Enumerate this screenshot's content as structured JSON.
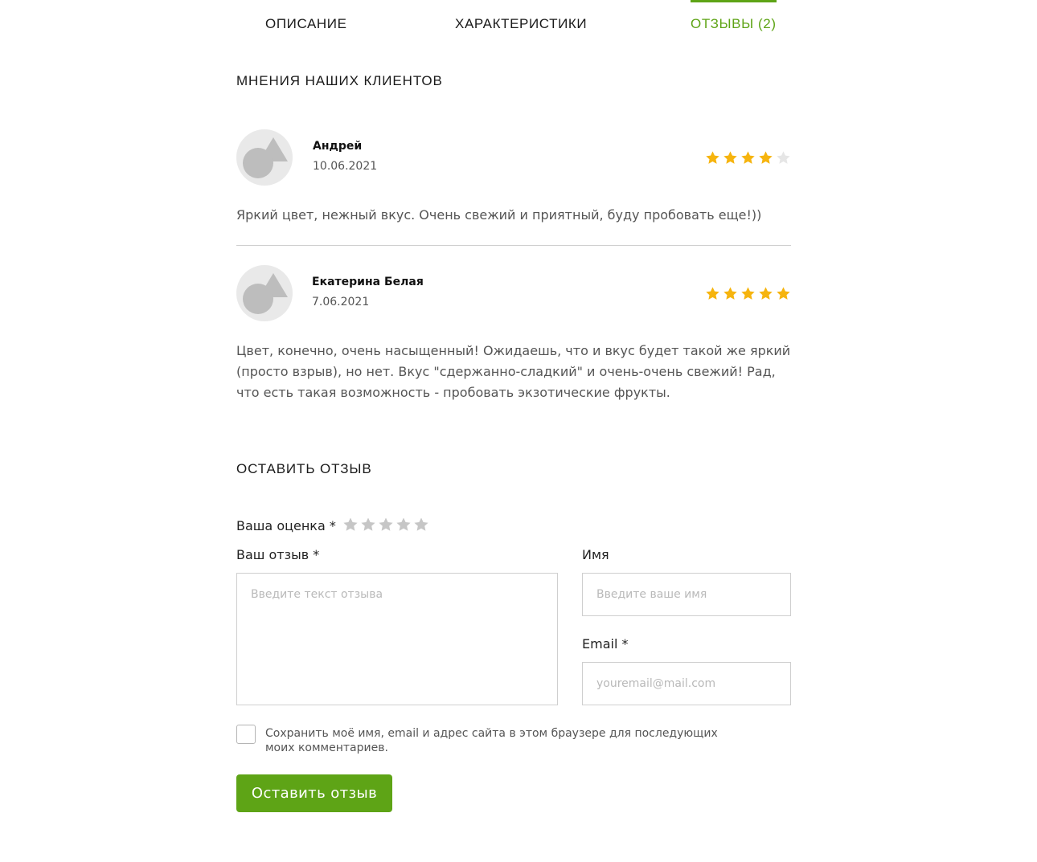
{
  "tabs": {
    "description": "ОПИСАНИЕ",
    "specs": "ХАРАКТЕРИСТИКИ",
    "reviews": "ОТЗЫВЫ (2)"
  },
  "colors": {
    "accent": "#5ea416",
    "star_filled": "#f6b40e",
    "star_empty": "#e6e6e6",
    "star_input": "#c6c6c6"
  },
  "reviews_section": {
    "title": "МНЕНИЯ НАШИХ КЛИЕНТОВ",
    "items": [
      {
        "author": "Андрей",
        "date": "10.06.2021",
        "rating": 4,
        "rating_max": 5,
        "text": "Яркий цвет, нежный вкус. Очень свежий и приятный, буду пробовать еще!))"
      },
      {
        "author": "Екатерина Белая",
        "date": "7.06.2021",
        "rating": 5,
        "rating_max": 5,
        "text": "Цвет, конечно, очень насыщенный! Ожидаешь, что и вкус будет такой же яркий (просто взрыв), но нет. Вкус \"сдержанно-сладкий\" и очень-очень свежий! Рад, что есть такая возможность - пробовать экзотические фрукты."
      }
    ]
  },
  "form": {
    "title": "ОСТАВИТЬ ОТЗЫВ",
    "rating_label": "Ваша оценка *",
    "review_label": "Ваш отзыв *",
    "review_placeholder": "Введите текст отзыва",
    "name_label": "Имя",
    "name_placeholder": "Введите ваше имя",
    "email_label": "Email *",
    "email_placeholder": "youremail@mail.com",
    "save_info_label": "Сохранить моё имя, email и адрес сайта в этом браузере для последующих моих комментариев.",
    "submit_label": "Оставить отзыв"
  }
}
